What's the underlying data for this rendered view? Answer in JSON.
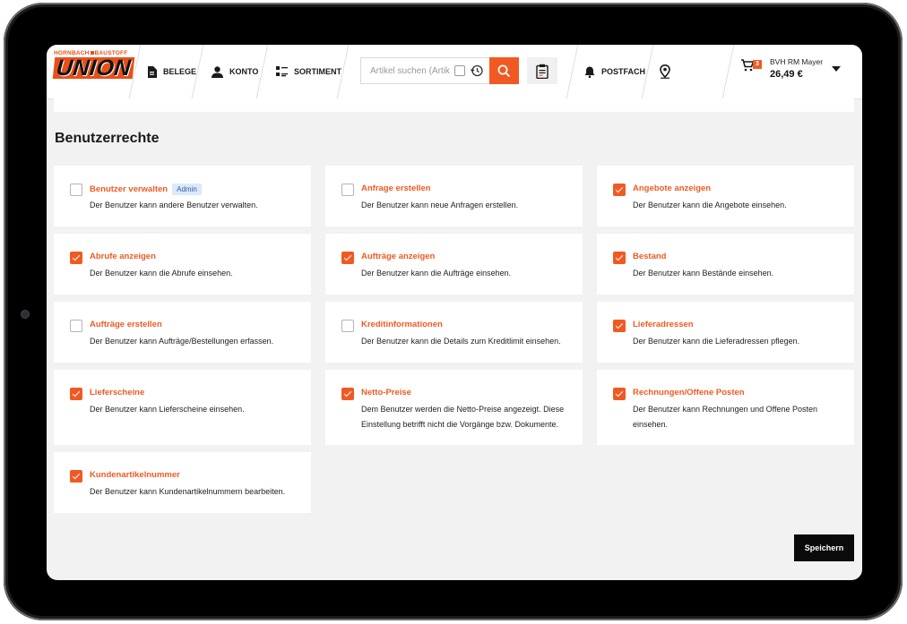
{
  "brand": {
    "top_left": "HORNBACH",
    "top_right": "BAUSTOFF",
    "name": "UNION"
  },
  "nav": [
    {
      "label": "BELEGE",
      "icon": "document-icon"
    },
    {
      "label": "KONTO",
      "icon": "user-icon"
    },
    {
      "label": "SORTIMENT",
      "icon": "grid-list-icon"
    },
    {
      "label": "POSTFACH",
      "icon": "bell-icon"
    }
  ],
  "search": {
    "placeholder": "Artikel suchen (Artik"
  },
  "cart": {
    "count": "3"
  },
  "account": {
    "name": "BVH RM Mayer",
    "amount": "26,49 €"
  },
  "page": {
    "title": "Benutzerrechte"
  },
  "permissions": [
    {
      "title": "Benutzer verwalten",
      "badge": "Admin",
      "desc": "Der Benutzer kann andere Benutzer verwalten.",
      "checked": false
    },
    {
      "title": "Anfrage erstellen",
      "desc": "Der Benutzer kann neue Anfragen erstellen.",
      "checked": false
    },
    {
      "title": "Angebote anzeigen",
      "desc": "Der Benutzer kann die Angebote einsehen.",
      "checked": true
    },
    {
      "title": "Abrufe anzeigen",
      "desc": "Der Benutzer kann die Abrufe einsehen.",
      "checked": true
    },
    {
      "title": "Aufträge anzeigen",
      "desc": "Der Benutzer kann die Aufträge einsehen.",
      "checked": true
    },
    {
      "title": "Bestand",
      "desc": "Der Benutzer kann Bestände einsehen.",
      "checked": true
    },
    {
      "title": "Aufträge erstellen",
      "desc": "Der Benutzer kann Aufträge/Bestellungen erfassen.",
      "checked": false
    },
    {
      "title": "Kreditinformationen",
      "desc": "Der Benutzer kann die Details zum Kreditlimit einsehen.",
      "checked": false
    },
    {
      "title": "Lieferadressen",
      "desc": "Der Benutzer kann die Lieferadressen pflegen.",
      "checked": true
    },
    {
      "title": "Lieferscheine",
      "desc": "Der Benutzer kann Lieferscheine einsehen.",
      "checked": true
    },
    {
      "title": "Netto-Preise",
      "desc": "Dem Benutzer werden die Netto-Preise angezeigt. Diese Einstellung betrifft nicht die Vorgänge bzw. Dokumente.",
      "checked": true
    },
    {
      "title": "Rechnungen/Offene Posten",
      "desc": "Der Benutzer kann Rechnungen und Offene Posten einsehen.",
      "checked": true
    },
    {
      "title": "Kundenartikelnummer",
      "desc": "Der Benutzer kann Kundenartikelnummern bearbeiten.",
      "checked": true
    }
  ],
  "actions": {
    "save": "Speichern"
  },
  "colors": {
    "accent": "#f05a22",
    "text": "#1a1a1a",
    "background": "#f2f2f2",
    "badge_bg": "#dbe9fb",
    "badge_text": "#2a5fa8"
  }
}
